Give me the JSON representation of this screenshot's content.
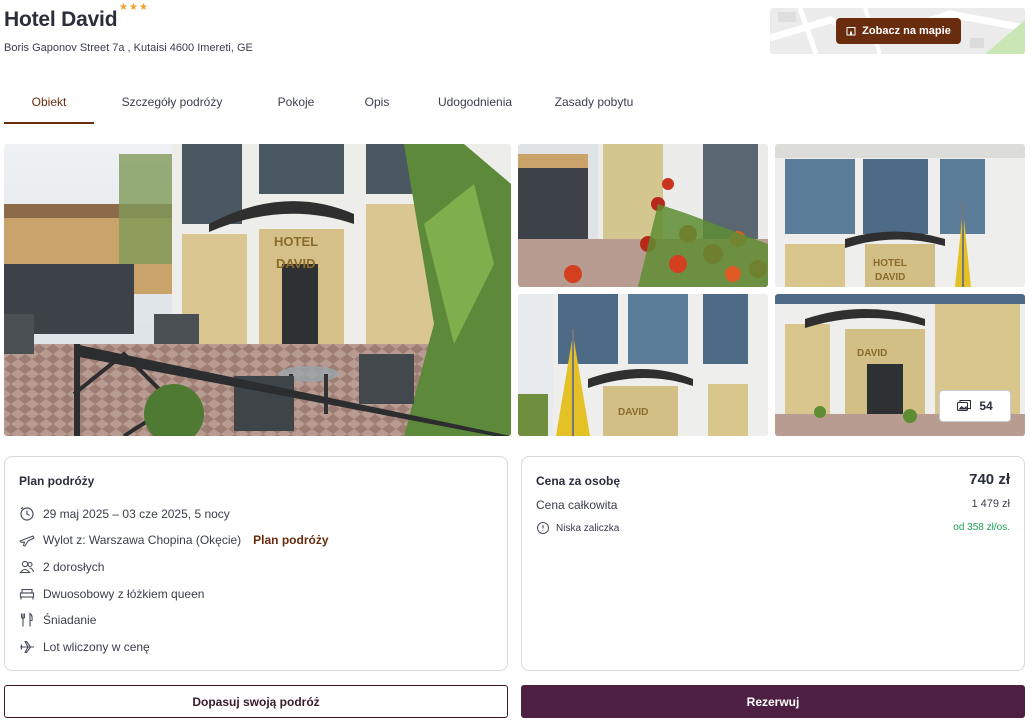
{
  "header": {
    "hotel_name": "Hotel David",
    "star_count": 3,
    "stars": [
      "★",
      "★",
      "★"
    ],
    "address": "Boris Gaponov Street 7a , Kutaisi 4600 Imereti, GE",
    "map_button_label": "Zobacz na mapie"
  },
  "tabs": [
    {
      "label": "Obiekt",
      "active": true
    },
    {
      "label": "Szczegóły podróży",
      "active": false
    },
    {
      "label": "Pokoje",
      "active": false
    },
    {
      "label": "Opis",
      "active": false
    },
    {
      "label": "Udogodnienia",
      "active": false
    },
    {
      "label": "Zasady pobytu",
      "active": false
    }
  ],
  "gallery": {
    "photo_count": "54",
    "hotel_sign": "HOTEL DAVID"
  },
  "plan": {
    "title": "Plan podróży",
    "dates": "29 maj 2025 – 03 cze 2025, 5 nocy",
    "flight": "Wylot z: Warszawa Chopina (Okęcie)",
    "flight_link": "Plan podróży",
    "guests": "2 dorosłych",
    "room": "Dwuosobowy z łóżkiem queen",
    "board": "Śniadanie",
    "flight_included": "Lot wliczony w cenę"
  },
  "price": {
    "per_person_label": "Cena za osobę",
    "per_person_value": "740 zł",
    "total_label": "Cena całkowita",
    "total_value": "1 479 zł",
    "deposit_label": "Niska zaliczka",
    "deposit_value": "od 358 zł/os."
  },
  "actions": {
    "customize_label": "Dopasuj swoją podróż",
    "book_label": "Rezerwuj"
  },
  "colors": {
    "brand_brown": "#6a2c0f",
    "brand_plum": "#4d1f43",
    "star": "#f4a12c",
    "deposit_green": "#1f9d55"
  }
}
